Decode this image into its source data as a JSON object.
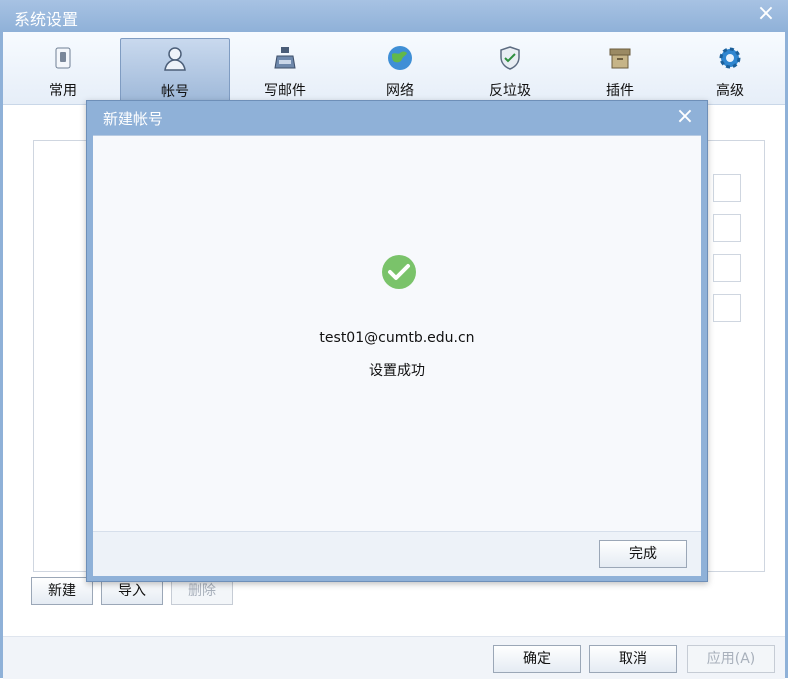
{
  "window": {
    "title": "系统设置"
  },
  "toolbar": {
    "items": [
      {
        "label": "常用",
        "icon": "switch-icon"
      },
      {
        "label": "帐号",
        "icon": "user-icon"
      },
      {
        "label": "写邮件",
        "icon": "ink-bottle-icon"
      },
      {
        "label": "网络",
        "icon": "globe-icon"
      },
      {
        "label": "反垃圾",
        "icon": "shield-icon"
      },
      {
        "label": "插件",
        "icon": "box-icon"
      },
      {
        "label": "高级",
        "icon": "gear-icon"
      }
    ],
    "active_index": 1
  },
  "account_actions": {
    "new_label": "新建",
    "import_label": "导入",
    "delete_label": "删除"
  },
  "footer": {
    "ok_label": "确定",
    "cancel_label": "取消",
    "apply_label": "应用(A)"
  },
  "dialog": {
    "title": "新建帐号",
    "email": "test01@cumtb.edu.cn",
    "message": "设置成功",
    "done_label": "完成"
  },
  "colors": {
    "titlebar": "#8fb1d8",
    "success": "#7ac36a"
  }
}
